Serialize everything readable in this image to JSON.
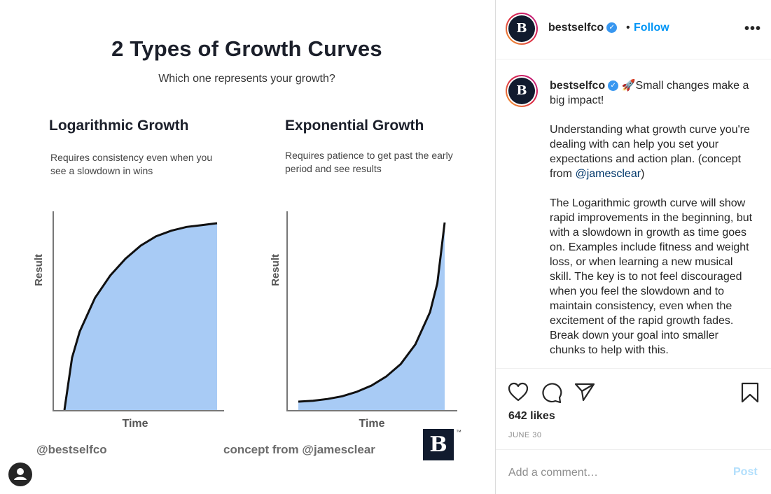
{
  "post_image": {
    "title": "2 Types of Growth Curves",
    "subtitle": "Which one represents your growth?",
    "left_chart": {
      "heading": "Logarithmic Growth",
      "description": "Requires consistency even when you see a slowdown in wins"
    },
    "right_chart": {
      "heading": "Exponential Growth",
      "description": "Requires patience to get past the early period and see results"
    },
    "footer_handle": "@bestselfco",
    "footer_concept": "concept from @jamesclear",
    "logo_letter": "B",
    "logo_tm": "™"
  },
  "chart_data": [
    {
      "type": "area",
      "title": "Logarithmic Growth",
      "xlabel": "Time",
      "ylabel": "Result",
      "x": [
        0,
        0.05,
        0.1,
        0.2,
        0.3,
        0.4,
        0.5,
        0.6,
        0.7,
        0.8,
        0.9,
        1.0
      ],
      "values": [
        0,
        0.28,
        0.42,
        0.6,
        0.72,
        0.81,
        0.88,
        0.93,
        0.96,
        0.98,
        0.99,
        1.0
      ],
      "fill_color": "#a8cbf5",
      "line_color": "#111111"
    },
    {
      "type": "area",
      "title": "Exponential Growth",
      "xlabel": "Time",
      "ylabel": "Result",
      "x": [
        0,
        0.1,
        0.2,
        0.3,
        0.4,
        0.5,
        0.6,
        0.7,
        0.8,
        0.9,
        0.95,
        1.0
      ],
      "values": [
        0,
        0.005,
        0.015,
        0.03,
        0.055,
        0.09,
        0.14,
        0.21,
        0.32,
        0.5,
        0.66,
        1.0
      ],
      "fill_color": "#a8cbf5",
      "line_color": "#111111"
    }
  ],
  "header": {
    "username": "bestselfco",
    "verified_icon": "✓",
    "separator": "•",
    "follow_label": "Follow",
    "more_icon": "•••",
    "avatar_letter": "B"
  },
  "caption": {
    "username": "bestselfco",
    "emoji": "🚀",
    "intro": "Small changes make a big impact!",
    "p1_text": "Understanding what growth curve you're dealing with can help you set your expectations and action plan. (concept from ",
    "p1_mention": "@jamesclear",
    "p1_end": ")",
    "p2": "The Logarithmic growth curve will show rapid improvements in the beginning, but with a slowdown in growth as time goes on. Examples include fitness and weight loss, or when learning a new musical skill. The key is to not feel discouraged when you feel the slowdown and to maintain consistency, even when the excitement of the rapid growth fades. Break down your goal into smaller chunks to help with this."
  },
  "actions": {
    "likes": "642 likes",
    "date": "JUNE 30"
  },
  "comment": {
    "placeholder": "Add a comment…",
    "post_label": "Post"
  },
  "colors": {
    "accent": "#0095f6",
    "verified": "#3897f0",
    "logo_bg": "#111b2e",
    "area_fill": "#a8cbf5"
  }
}
